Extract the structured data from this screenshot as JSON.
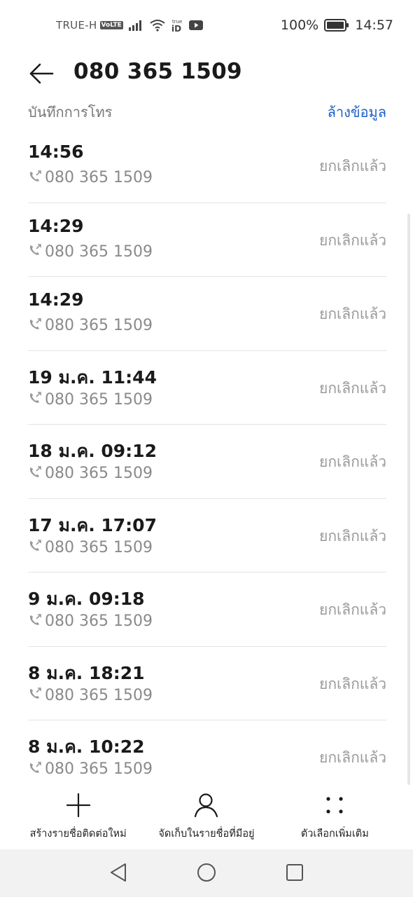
{
  "status_bar": {
    "carrier": "TRUE-H",
    "volte": "VoLTE",
    "battery_percent": "100%",
    "time": "14:57",
    "icons": [
      "signal-icon",
      "wifi-icon",
      "true-id-icon",
      "youtube-icon",
      "battery-icon"
    ]
  },
  "header": {
    "back_icon": "arrow-left-icon",
    "title": "080 365 1509"
  },
  "sub_header": {
    "section_label": "บันทึกการโทร",
    "clear_label": "ล้างข้อมูล"
  },
  "calls": [
    {
      "time": "14:56",
      "number": "080 365 1509",
      "status": "ยกเลิกแล้ว"
    },
    {
      "time": "14:29",
      "number": "080 365 1509",
      "status": "ยกเลิกแล้ว"
    },
    {
      "time": "14:29",
      "number": "080 365 1509",
      "status": "ยกเลิกแล้ว"
    },
    {
      "time": "19 ม.ค. 11:44",
      "number": "080 365 1509",
      "status": "ยกเลิกแล้ว"
    },
    {
      "time": "18 ม.ค. 09:12",
      "number": "080 365 1509",
      "status": "ยกเลิกแล้ว"
    },
    {
      "time": "17 ม.ค. 17:07",
      "number": "080 365 1509",
      "status": "ยกเลิกแล้ว"
    },
    {
      "time": "9 ม.ค. 09:18",
      "number": "080 365 1509",
      "status": "ยกเลิกแล้ว"
    },
    {
      "time": "8 ม.ค. 18:21",
      "number": "080 365 1509",
      "status": "ยกเลิกแล้ว"
    },
    {
      "time": "8 ม.ค. 10:22",
      "number": "080 365 1509",
      "status": "ยกเลิกแล้ว"
    }
  ],
  "actions": {
    "new_contact": "สร้างรายชื่อติดต่อใหม่",
    "save_existing": "จัดเก็บในรายชื่อที่มีอยู่",
    "more_options": "ตัวเลือกเพิ่มเติม"
  },
  "colors": {
    "accent": "#1d5fc8",
    "secondary_text": "#8a8a8a",
    "nav_bar_bg": "#f2f2f2"
  }
}
